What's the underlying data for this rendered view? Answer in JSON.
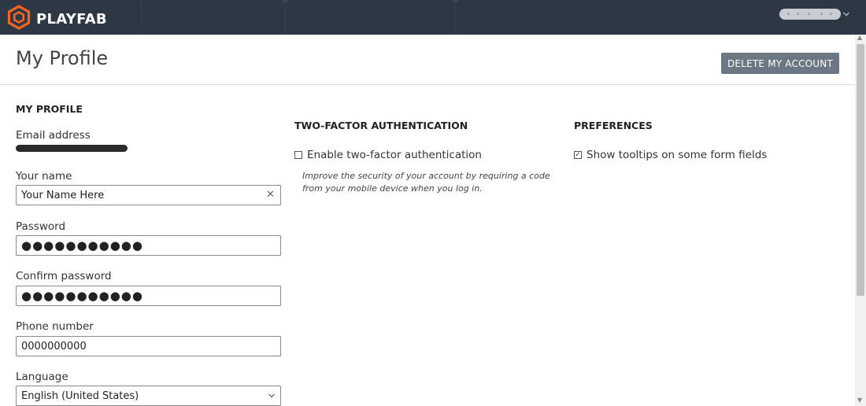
{
  "app": {
    "brand": "PLAYFAB",
    "colors": {
      "topbar": "#2e3844",
      "logo_accent": "#f26522",
      "button": "#6c7784"
    }
  },
  "icons": {
    "logo": "playfab-hexagon-logo",
    "user_menu_chevron": "chevron-down-icon",
    "clear": "close-icon",
    "select_chevron": "chevron-down-icon"
  },
  "header": {
    "title": "My Profile",
    "delete_button_label": "DELETE MY ACCOUNT"
  },
  "profile": {
    "heading": "MY PROFILE",
    "email_label": "Email address",
    "name_label": "Your name",
    "name_value": "Your Name Here",
    "password_label": "Password",
    "password_value": "●●●●●●●●●●●",
    "confirm_label": "Confirm password",
    "confirm_value": "●●●●●●●●●●●",
    "phone_label": "Phone number",
    "phone_value": "0000000000",
    "language_label": "Language",
    "language_value": "English (United States)"
  },
  "two_factor": {
    "heading": "TWO-FACTOR AUTHENTICATION",
    "checkbox_label": "Enable two-factor authentication",
    "checked": false,
    "help_text": "Improve the security of your account by requiring a code from your mobile device when you log in."
  },
  "preferences": {
    "heading": "PREFERENCES",
    "tooltips_label": "Show tooltips on some form fields",
    "checked": true
  }
}
